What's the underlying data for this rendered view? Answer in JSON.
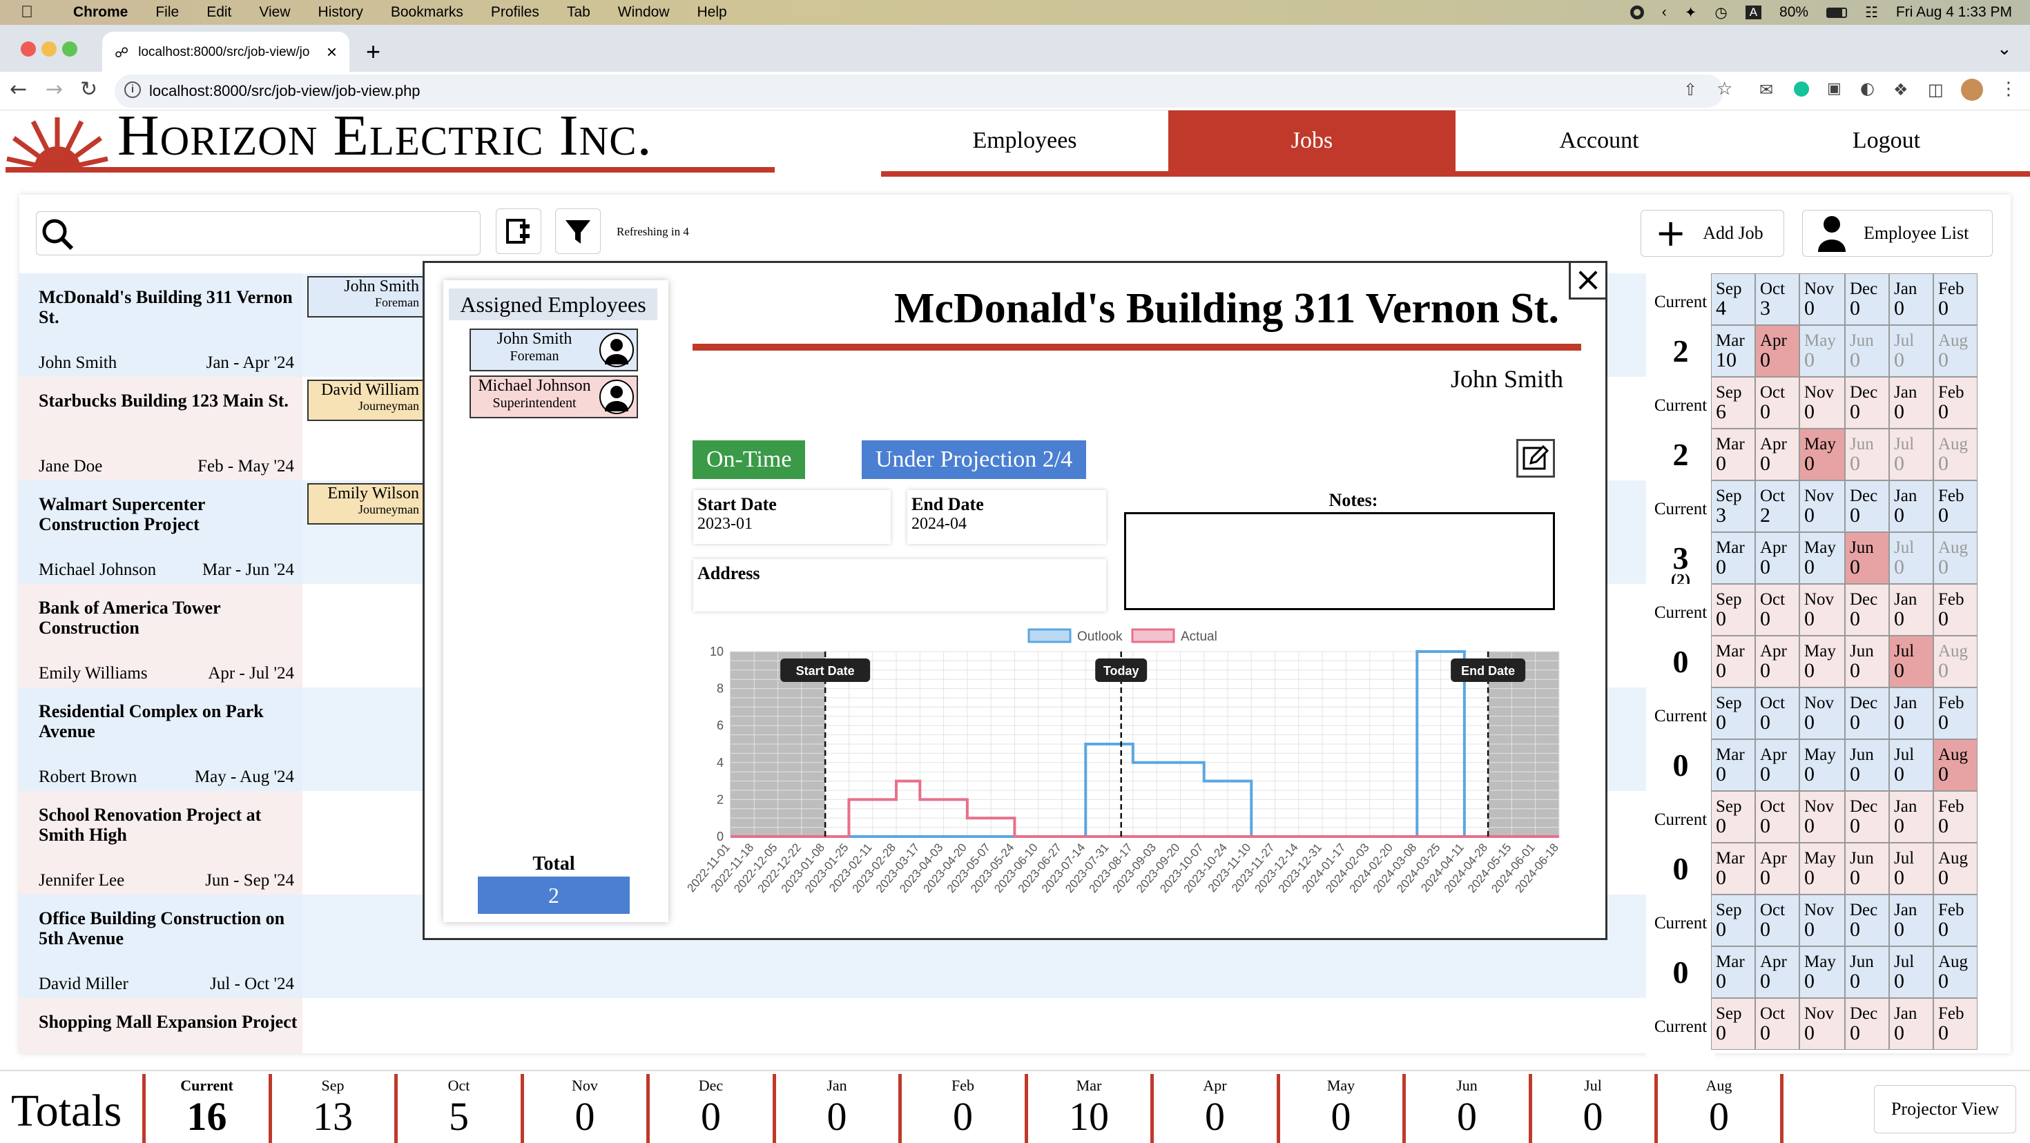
{
  "menubar": {
    "app": "Chrome",
    "items": [
      "File",
      "Edit",
      "View",
      "History",
      "Bookmarks",
      "Profiles",
      "Tab",
      "Window",
      "Help"
    ],
    "battery": "80%",
    "clock": "Fri Aug 4  1:33 PM"
  },
  "browser": {
    "tab_title": "localhost:8000/src/job-view/jo",
    "url": "localhost:8000/src/job-view/job-view.php"
  },
  "site": {
    "logo_text": "Horizon Electric Inc.",
    "nav": [
      "Employees",
      "Jobs",
      "Account",
      "Logout"
    ],
    "active_nav": "Jobs"
  },
  "toolbar": {
    "search_placeholder": "",
    "refresh_text": "Refreshing in 4",
    "add_job": "Add Job",
    "employee_list": "Employee List"
  },
  "jobs": [
    {
      "name": "McDonald's Building 311 Vernon St.",
      "employee": "John Smith",
      "dates": "Jan - Apr '24"
    },
    {
      "name": "Starbucks Building 123 Main St.",
      "employee": "Jane Doe",
      "dates": "Feb - May '24"
    },
    {
      "name": "Walmart Supercenter Construction Project",
      "employee": "Michael Johnson",
      "dates": "Mar - Jun '24"
    },
    {
      "name": "Bank of America Tower Construction",
      "employee": "Emily Williams",
      "dates": "Apr - Jul '24"
    },
    {
      "name": "Residential Complex on Park Avenue",
      "employee": "Robert Brown",
      "dates": "May - Aug '24"
    },
    {
      "name": "School Renovation Project at Smith High",
      "employee": "Jennifer Lee",
      "dates": "Jun - Sep '24"
    },
    {
      "name": "Office Building Construction on 5th Avenue",
      "employee": "David Miller",
      "dates": "Jul - Oct '24"
    },
    {
      "name": "Shopping Mall Expansion Project",
      "employee": "",
      "dates": ""
    }
  ],
  "crew": [
    {
      "name": "John Smith",
      "role": "Foreman"
    },
    {
      "name": "David William",
      "role": "Journeyman"
    },
    {
      "name": "Emily Wilson",
      "role": "Journeyman"
    }
  ],
  "grid": {
    "current_label": "Current",
    "rows": [
      {
        "current": "2",
        "sub": "",
        "top": [
          [
            "Sep",
            "4"
          ],
          [
            "Oct",
            "3"
          ],
          [
            "Nov",
            "0"
          ],
          [
            "Dec",
            "0"
          ],
          [
            "Jan",
            "0"
          ],
          [
            "Feb",
            "0"
          ]
        ],
        "bottom": [
          [
            "Mar",
            "10"
          ],
          [
            "Apr",
            "0"
          ],
          [
            "May",
            "0"
          ],
          [
            "Jun",
            "0"
          ],
          [
            "Jul",
            "0"
          ],
          [
            "Aug",
            "0"
          ]
        ]
      },
      {
        "current": "2",
        "sub": "",
        "top": [
          [
            "Sep",
            "6"
          ],
          [
            "Oct",
            "0"
          ],
          [
            "Nov",
            "0"
          ],
          [
            "Dec",
            "0"
          ],
          [
            "Jan",
            "0"
          ],
          [
            "Feb",
            "0"
          ]
        ],
        "bottom": [
          [
            "Mar",
            "0"
          ],
          [
            "Apr",
            "0"
          ],
          [
            "May",
            "0"
          ],
          [
            "Jun",
            "0"
          ],
          [
            "Jul",
            "0"
          ],
          [
            "Aug",
            "0"
          ]
        ]
      },
      {
        "current": "3",
        "sub": "(2)",
        "top": [
          [
            "Sep",
            "3"
          ],
          [
            "Oct",
            "2"
          ],
          [
            "Nov",
            "0"
          ],
          [
            "Dec",
            "0"
          ],
          [
            "Jan",
            "0"
          ],
          [
            "Feb",
            "0"
          ]
        ],
        "bottom": [
          [
            "Mar",
            "0"
          ],
          [
            "Apr",
            "0"
          ],
          [
            "May",
            "0"
          ],
          [
            "Jun",
            "0"
          ],
          [
            "Jul",
            "0"
          ],
          [
            "Aug",
            "0"
          ]
        ]
      },
      {
        "current": "0",
        "sub": "",
        "top": [
          [
            "Sep",
            "0"
          ],
          [
            "Oct",
            "0"
          ],
          [
            "Nov",
            "0"
          ],
          [
            "Dec",
            "0"
          ],
          [
            "Jan",
            "0"
          ],
          [
            "Feb",
            "0"
          ]
        ],
        "bottom": [
          [
            "Mar",
            "0"
          ],
          [
            "Apr",
            "0"
          ],
          [
            "May",
            "0"
          ],
          [
            "Jun",
            "0"
          ],
          [
            "Jul",
            "0"
          ],
          [
            "Aug",
            "0"
          ]
        ]
      },
      {
        "current": "0",
        "sub": "",
        "top": [
          [
            "Sep",
            "0"
          ],
          [
            "Oct",
            "0"
          ],
          [
            "Nov",
            "0"
          ],
          [
            "Dec",
            "0"
          ],
          [
            "Jan",
            "0"
          ],
          [
            "Feb",
            "0"
          ]
        ],
        "bottom": [
          [
            "Mar",
            "0"
          ],
          [
            "Apr",
            "0"
          ],
          [
            "May",
            "0"
          ],
          [
            "Jun",
            "0"
          ],
          [
            "Jul",
            "0"
          ],
          [
            "Aug",
            "0"
          ]
        ]
      },
      {
        "current": "0",
        "sub": "",
        "top": [
          [
            "Sep",
            "0"
          ],
          [
            "Oct",
            "0"
          ],
          [
            "Nov",
            "0"
          ],
          [
            "Dec",
            "0"
          ],
          [
            "Jan",
            "0"
          ],
          [
            "Feb",
            "0"
          ]
        ],
        "bottom": [
          [
            "Mar",
            "0"
          ],
          [
            "Apr",
            "0"
          ],
          [
            "May",
            "0"
          ],
          [
            "Jun",
            "0"
          ],
          [
            "Jul",
            "0"
          ],
          [
            "Aug",
            "0"
          ]
        ]
      },
      {
        "current": "0",
        "sub": "",
        "top": [
          [
            "Sep",
            "0"
          ],
          [
            "Oct",
            "0"
          ],
          [
            "Nov",
            "0"
          ],
          [
            "Dec",
            "0"
          ],
          [
            "Jan",
            "0"
          ],
          [
            "Feb",
            "0"
          ]
        ],
        "bottom": [
          [
            "Mar",
            "0"
          ],
          [
            "Apr",
            "0"
          ],
          [
            "May",
            "0"
          ],
          [
            "Jun",
            "0"
          ],
          [
            "Jul",
            "0"
          ],
          [
            "Aug",
            "0"
          ]
        ]
      },
      {
        "current": "",
        "sub": "",
        "top": [
          [
            "Sep",
            "0"
          ],
          [
            "Oct",
            "0"
          ],
          [
            "Nov",
            "0"
          ],
          [
            "Dec",
            "0"
          ],
          [
            "Jan",
            "0"
          ],
          [
            "Feb",
            "0"
          ]
        ],
        "bottom": []
      }
    ]
  },
  "totals": {
    "label": "Totals",
    "columns": [
      {
        "month": "Current",
        "value": "16"
      },
      {
        "month": "Sep",
        "value": "13"
      },
      {
        "month": "Oct",
        "value": "5"
      },
      {
        "month": "Nov",
        "value": "0"
      },
      {
        "month": "Dec",
        "value": "0"
      },
      {
        "month": "Jan",
        "value": "0"
      },
      {
        "month": "Feb",
        "value": "0"
      },
      {
        "month": "Mar",
        "value": "10"
      },
      {
        "month": "Apr",
        "value": "0"
      },
      {
        "month": "May",
        "value": "0"
      },
      {
        "month": "Jun",
        "value": "0"
      },
      {
        "month": "Jul",
        "value": "0"
      },
      {
        "month": "Aug",
        "value": "0"
      }
    ],
    "projector": "Projector View"
  },
  "modal": {
    "assigned_title": "Assigned Employees",
    "employees": [
      {
        "name": "John Smith",
        "role": "Foreman"
      },
      {
        "name": "Michael Johnson",
        "role": "Superintendent"
      }
    ],
    "total_label": "Total",
    "total_value": "2",
    "title": "McDonald's Building 311 Vernon St.",
    "foreman": "John Smith",
    "status_time": "On-Time",
    "status_projection": "Under Projection 2/4",
    "start_label": "Start Date",
    "start_value": "2023-01",
    "end_label": "End Date",
    "end_value": "2024-04",
    "address_label": "Address",
    "address_value": "",
    "notes_label": "Notes:"
  },
  "colors": {
    "brand_red": "#c0392b",
    "on_time": "#3a9a48",
    "projection": "#4a7fd1",
    "outlook": "#5aa7e0",
    "actual": "#e8708a"
  },
  "chart_data": {
    "type": "line",
    "x": [
      "2022-11-01",
      "2022-11-18",
      "2022-12-05",
      "2022-12-22",
      "2023-01-08",
      "2023-01-25",
      "2023-02-11",
      "2023-02-28",
      "2023-03-17",
      "2023-04-03",
      "2023-04-20",
      "2023-05-07",
      "2023-05-24",
      "2023-06-10",
      "2023-06-27",
      "2023-07-14",
      "2023-07-31",
      "2023-08-17",
      "2023-09-03",
      "2023-09-20",
      "2023-10-07",
      "2023-10-24",
      "2023-11-10",
      "2023-11-27",
      "2023-12-14",
      "2023-12-31",
      "2024-01-17",
      "2024-02-03",
      "2024-02-20",
      "2024-03-08",
      "2024-03-25",
      "2024-04-11",
      "2024-04-28",
      "2024-05-15",
      "2024-06-01",
      "2024-06-18"
    ],
    "series": [
      {
        "name": "Outlook",
        "values": [
          0,
          0,
          0,
          0,
          0,
          0,
          0,
          0,
          0,
          0,
          0,
          0,
          0,
          0,
          0,
          5,
          5,
          4,
          4,
          4,
          3,
          3,
          0,
          0,
          0,
          0,
          0,
          0,
          0,
          10,
          10,
          0,
          0,
          0,
          0,
          0
        ]
      },
      {
        "name": "Actual",
        "values": [
          0,
          0,
          0,
          0,
          0,
          2,
          2,
          3,
          2,
          2,
          1,
          1,
          0,
          0,
          0,
          0,
          0,
          0,
          0,
          0,
          0,
          0,
          0,
          0,
          0,
          0,
          0,
          0,
          0,
          0,
          0,
          0,
          0,
          0,
          0,
          0
        ]
      }
    ],
    "annotations": [
      "Start Date",
      "Today",
      "End Date"
    ],
    "ylim": [
      0,
      10
    ],
    "yticks": [
      0,
      2,
      4,
      6,
      8,
      10
    ],
    "legend": "top"
  }
}
